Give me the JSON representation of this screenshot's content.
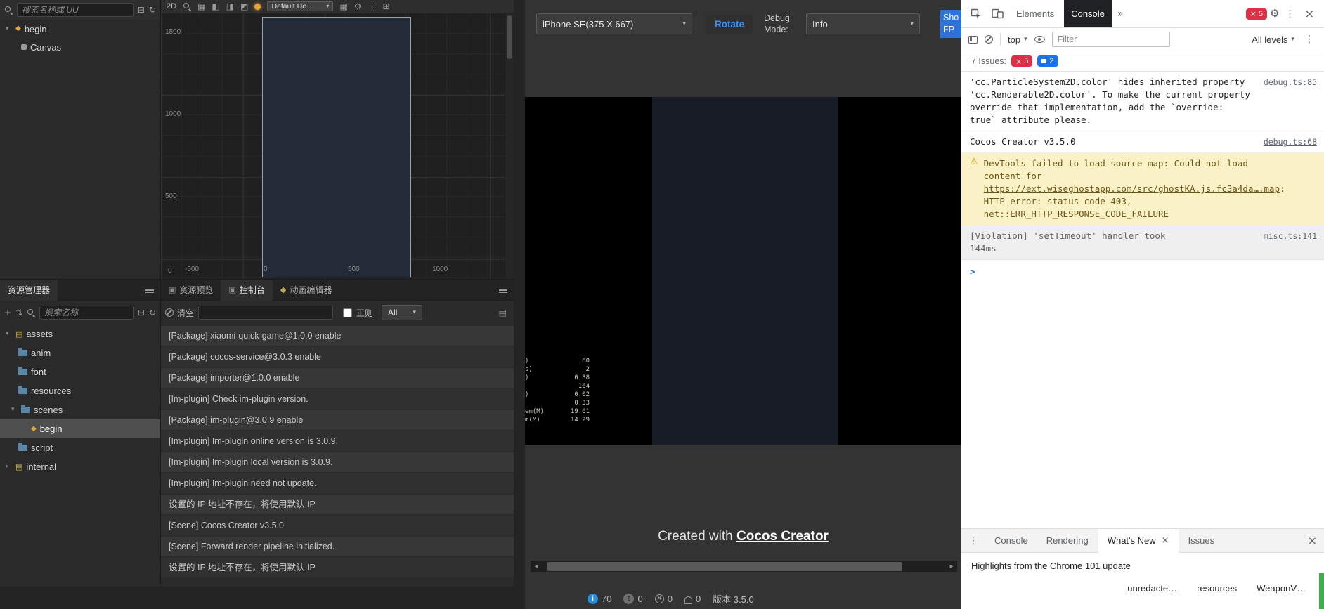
{
  "colors": {
    "accent_blue": "#3b8ef3",
    "fps_button_blue": "#2d72d9",
    "error_red": "#e02f44",
    "issue_blue": "#1a73e8",
    "warning_bg": "#fbf1c7",
    "scene_orange": "#e8a33d",
    "status_info_blue": "#2a8cd4",
    "drawer_green": "#3dae49"
  },
  "editor": {
    "hierarchy": {
      "search_placeholder": "搜索名称或 UU",
      "nodes": [
        {
          "label": "begin"
        },
        {
          "label": "Canvas"
        }
      ]
    },
    "scene": {
      "mode_2d": "2D",
      "preset": "Default De...",
      "ruler_v": [
        "1500",
        "1000",
        "500",
        "0"
      ],
      "ruler_h": [
        "-500",
        "0",
        "500",
        "1000"
      ]
    },
    "assets": {
      "title": "资源管理器",
      "search_placeholder": "搜索名称",
      "tree": [
        {
          "label": "assets"
        },
        {
          "label": "anim"
        },
        {
          "label": "font"
        },
        {
          "label": "resources"
        },
        {
          "label": "scenes"
        },
        {
          "label": "begin"
        },
        {
          "label": "script"
        },
        {
          "label": "internal"
        }
      ]
    },
    "console": {
      "tabs": [
        {
          "label": "资源预览"
        },
        {
          "label": "控制台"
        },
        {
          "label": "动画编辑器"
        }
      ],
      "clear_label": "清空",
      "regex_label": "正则",
      "level_filter": "All",
      "logs": [
        "[Package] xiaomi-quick-game@1.0.0 enable",
        "[Package] cocos-service@3.0.3 enable",
        "[Package] importer@1.0.0 enable",
        "[Im-plugin] Check im-plugin version.",
        "[Package] im-plugin@3.0.9 enable",
        "[Im-plugin] Im-plugin online version is 3.0.9.",
        "[Im-plugin] Im-plugin local version is 3.0.9.",
        "[Im-plugin] Im-plugin need not update.",
        "设置的 IP 地址不存在，将使用默认 IP",
        "[Scene] Cocos Creator v3.5.0",
        "[Scene] Forward render pipeline initialized.",
        "设置的 IP 地址不存在，将使用默认 IP"
      ]
    },
    "statusbar": {
      "info_count": "70",
      "warn_count": "0",
      "error_count": "0",
      "notice_count": "0",
      "version": "版本 3.5.0"
    }
  },
  "preview": {
    "device": "iPhone SE(375 X 667)",
    "rotate_label": "Rotate",
    "debug_mode_label": "Debug Mode:",
    "debug_mode_value": "Info",
    "show_fps_label": "Sho FP",
    "profiler": [
      {
        "label": ")",
        "value": "60"
      },
      {
        "label": "s)",
        "value": "2"
      },
      {
        "label": ")",
        "value": "0.38"
      },
      {
        "label": "",
        "value": "164"
      },
      {
        "label": ")",
        "value": "0.02"
      },
      {
        "label": "",
        "value": "0.33"
      },
      {
        "label": "em(M)",
        "value": "19.61"
      },
      {
        "label": "m(M)",
        "value": "14.29"
      }
    ],
    "credit_prefix": "Created with ",
    "credit_link": "Cocos Creator"
  },
  "devtools": {
    "tab_elements": "Elements",
    "tab_console": "Console",
    "error_badge": "5",
    "toolbar": {
      "context": "top",
      "filter_placeholder": "Filter",
      "levels": "All levels"
    },
    "issues_label": "7 Issues:",
    "issues_errors": "5",
    "issues_warnings": "2",
    "messages": [
      {
        "text": "'cc.ParticleSystem2D.color' hides inherited property 'cc.Renderable2D.color'. To make the current property override that implementation, add the `override: true` attribute please.",
        "link": "debug.ts:85"
      },
      {
        "text": "Cocos Creator v3.5.0",
        "link": "debug.ts:68"
      },
      {
        "pre": "DevTools failed to load source map: Could not load content for ",
        "url": "https://ext.wiseghostapp.com/src/ghostKA.js.fc3a4da….map",
        "post": ": HTTP error: status code 403, net::ERR_HTTP_RESPONSE_CODE_FAILURE"
      },
      {
        "text": "[Violation] 'setTimeout' handler took 144ms",
        "link": "misc.ts:141"
      }
    ],
    "drawer": {
      "tabs": [
        {
          "label": "Console"
        },
        {
          "label": "Rendering"
        },
        {
          "label": "What's New"
        },
        {
          "label": "Issues"
        }
      ],
      "content": "Highlights from the Chrome 101 update"
    },
    "bottom_items": [
      {
        "label": "unredacte…"
      },
      {
        "label": "resources"
      },
      {
        "label": "WeaponV…"
      }
    ]
  }
}
